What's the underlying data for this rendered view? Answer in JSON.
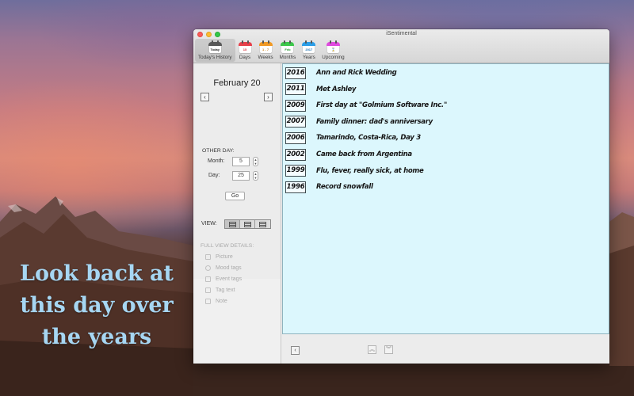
{
  "desktop": {
    "promo_lines": [
      "Look back at",
      "this day over",
      "the years"
    ]
  },
  "window": {
    "title": "iSentimental",
    "toolbar": [
      {
        "id": "todays-history",
        "label": "Today's History",
        "icon_text": "Today",
        "color": "#5a5a5a",
        "text_color": "#222222",
        "active": true
      },
      {
        "id": "days",
        "label": "Days",
        "icon_text": "15",
        "color": "#e8404a",
        "text_color": "#d8303a",
        "active": false
      },
      {
        "id": "weeks",
        "label": "Weeks",
        "icon_text": "1 - 7",
        "color": "#f29a24",
        "text_color": "#c97a10",
        "active": false
      },
      {
        "id": "months",
        "label": "Months",
        "icon_text": "Feb",
        "color": "#3cc84a",
        "text_color": "#22962c",
        "active": false
      },
      {
        "id": "years",
        "label": "Years",
        "icon_text": "2017",
        "color": "#2a9ee8",
        "text_color": "#1a6fb0",
        "active": false
      },
      {
        "id": "upcoming",
        "label": "Upcoming",
        "icon_text": "⌛",
        "color": "#e04adf",
        "text_color": "#b08a20",
        "active": false
      }
    ]
  },
  "sidebar": {
    "date_heading": "February 20",
    "prev_icon": "‹",
    "next_icon": "›",
    "other_day_label": "OTHER DAY:",
    "month_label": "Month:",
    "month_value": "5",
    "day_label": "Day:",
    "day_value": "25",
    "go_label": "Go",
    "view_label": "VIEW:",
    "view_options": [
      "list-compact",
      "list-detailed",
      "list-full"
    ],
    "view_selected": 0,
    "full_view_details_label": "FULL VIEW DETAILS:",
    "details": [
      {
        "label": "Picture",
        "icon": "picture-icon"
      },
      {
        "label": "Mood tags",
        "icon": "mood-icon"
      },
      {
        "label": "Event tags",
        "icon": "event-tag-icon"
      },
      {
        "label": "Tag text",
        "icon": "tag-text-icon"
      },
      {
        "label": "Note",
        "icon": "note-icon"
      }
    ]
  },
  "events": [
    {
      "year": "2016",
      "text": "Ann and Rick Wedding"
    },
    {
      "year": "2011",
      "text": "Met Ashley"
    },
    {
      "year": "2009",
      "text": "First day at \"Golmium Software Inc.\""
    },
    {
      "year": "2007",
      "text": "Family dinner: dad's anniversary"
    },
    {
      "year": "2006",
      "text": "Tamarindo, Costa-Rica, Day 3"
    },
    {
      "year": "2002",
      "text": "Came back from Argentina"
    },
    {
      "year": "1999",
      "text": "Flu, fever, really sick, at home"
    },
    {
      "year": "1996",
      "text": "Record snowfall"
    }
  ],
  "bottom_bar": {
    "back_icon": "‹",
    "scroll_up_icon": "︽",
    "scroll_down_icon": "︾"
  }
}
